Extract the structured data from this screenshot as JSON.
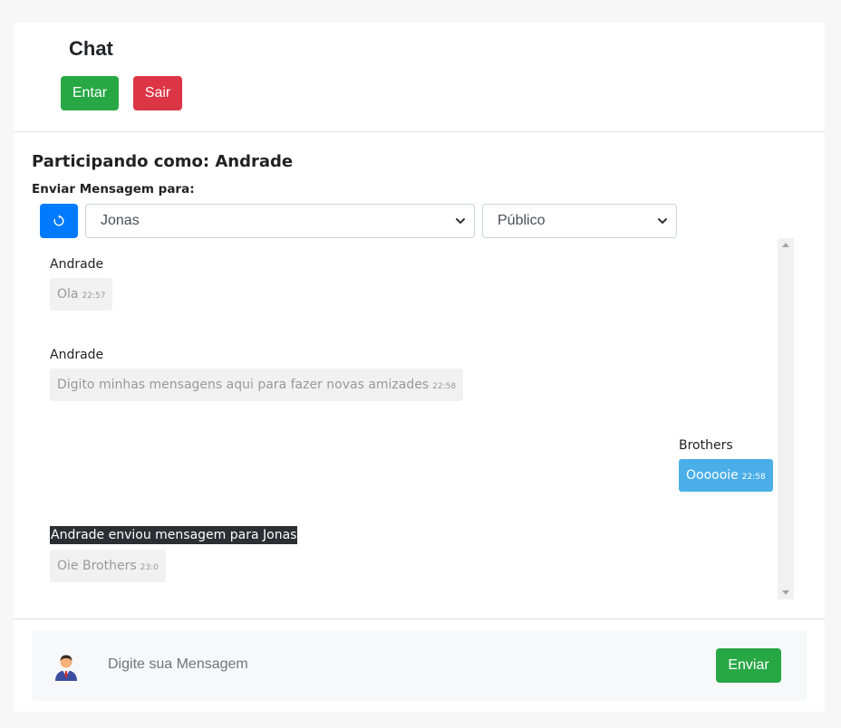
{
  "header": {
    "title": "Chat",
    "enter_label": "Entar",
    "exit_label": "Sair"
  },
  "session": {
    "participating": "Participando como: Andrade",
    "send_to_label": "Enviar Mensagem para:",
    "recipient": "Jonas",
    "visibility": "Público"
  },
  "messages": [
    {
      "author": "Andrade",
      "text": "Ola",
      "time": "22:57"
    },
    {
      "author": "Andrade",
      "text": "Digito minhas mensagens aqui para fazer novas amizades",
      "time": "22:58"
    },
    {
      "author": "Brothers",
      "text": "Oooooie",
      "time": "22:58"
    },
    {
      "author": "Andrade enviou mensagem para Jonas",
      "text": "Oie Brothers",
      "time": "23:0"
    }
  ],
  "footer": {
    "placeholder": "Digite sua Mensagem",
    "send_label": "Enviar"
  },
  "colors": {
    "green": "#28a745",
    "red": "#dc3545",
    "blue": "#007bff",
    "bubble_blue": "#4aaee8",
    "private_label_bg": "#2b2f33"
  },
  "icons": {
    "refresh": "refresh-icon",
    "chevron": "chevron-down-icon",
    "avatar": "user-avatar-icon"
  }
}
